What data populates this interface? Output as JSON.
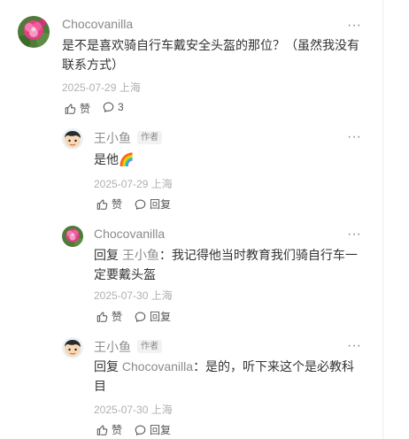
{
  "comment": {
    "author": "Chocovanilla",
    "text": "是不是喜欢骑自行车戴安全头盔的那位？（虽然我没有联系方式）",
    "meta": "2025-07-29 上海",
    "like_label": "赞",
    "reply_count": "3",
    "more_icon": "···"
  },
  "replies": [
    {
      "author": "王小鱼",
      "badge": "作者",
      "text": "是他",
      "emoji": "🌈",
      "meta": "2025-07-29 上海",
      "like_label": "赞",
      "reply_label": "回复",
      "more_icon": "···"
    },
    {
      "author": "Chocovanilla",
      "reply_prefix": "回复",
      "reply_to": "王小鱼",
      "text": "：我记得他当时教育我们骑自行车一定要戴头盔",
      "meta": "2025-07-30 上海",
      "like_label": "赞",
      "reply_label": "回复",
      "more_icon": "···"
    },
    {
      "author": "王小鱼",
      "badge": "作者",
      "reply_prefix": "回复",
      "reply_to": "Chocovanilla",
      "text": "：是的，听下来这个是必教科目",
      "meta": "2025-07-30 上海",
      "like_label": "赞",
      "reply_label": "回复",
      "more_icon": "···"
    }
  ]
}
